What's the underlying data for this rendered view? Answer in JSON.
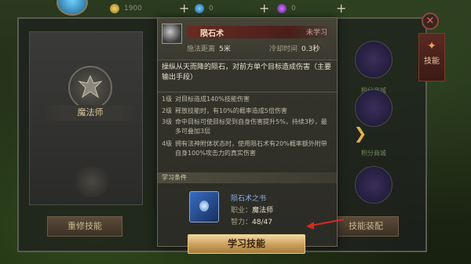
{
  "top_bar": {
    "gold": "1900",
    "diamond": "0",
    "purple_gem": "0",
    "plus": "+"
  },
  "class_panel": {
    "class_name": "魔法师",
    "reset_button": "重修技能"
  },
  "right_panel": {
    "skill_tab": "技能",
    "slot_captions": [
      "积分商城",
      "积分商城"
    ],
    "equip_button": "技能装配",
    "close": "×",
    "nav": "❯"
  },
  "popup": {
    "skill_name": "陨石术",
    "status": "未学习",
    "cast_range_label": "施法距离",
    "cast_range_value": "5米",
    "cooldown_label": "冷却时间",
    "cooldown_value": "0.3秒",
    "description": "操纵从天而降的陨石，对前方单个目标造成伤害（主要输出手段）",
    "levels": [
      {
        "level": "1级",
        "text": "对目标造成140%技能伤害"
      },
      {
        "level": "2级",
        "text": "释放技能时，有10%的概率造成5倍伤害"
      },
      {
        "level": "3级",
        "text": "命中目标可使目标受到自身伤害提升5%，持续3秒，最多可叠加3层"
      },
      {
        "level": "4级",
        "text": "拥有法神附体状态时，使用陨石术有20%概率额外附带自身100%攻击力的真实伤害"
      }
    ],
    "requirements_header": "学习条件",
    "requirement_item": "陨石术之书",
    "job_label": "职业：",
    "job_value": "魔法师",
    "int_label": "智力：",
    "int_value": "48/47",
    "learn_button": "学习技能"
  },
  "colors": {
    "accent_gold": "#c99e5a",
    "annotation_red": "#d42a1f"
  }
}
